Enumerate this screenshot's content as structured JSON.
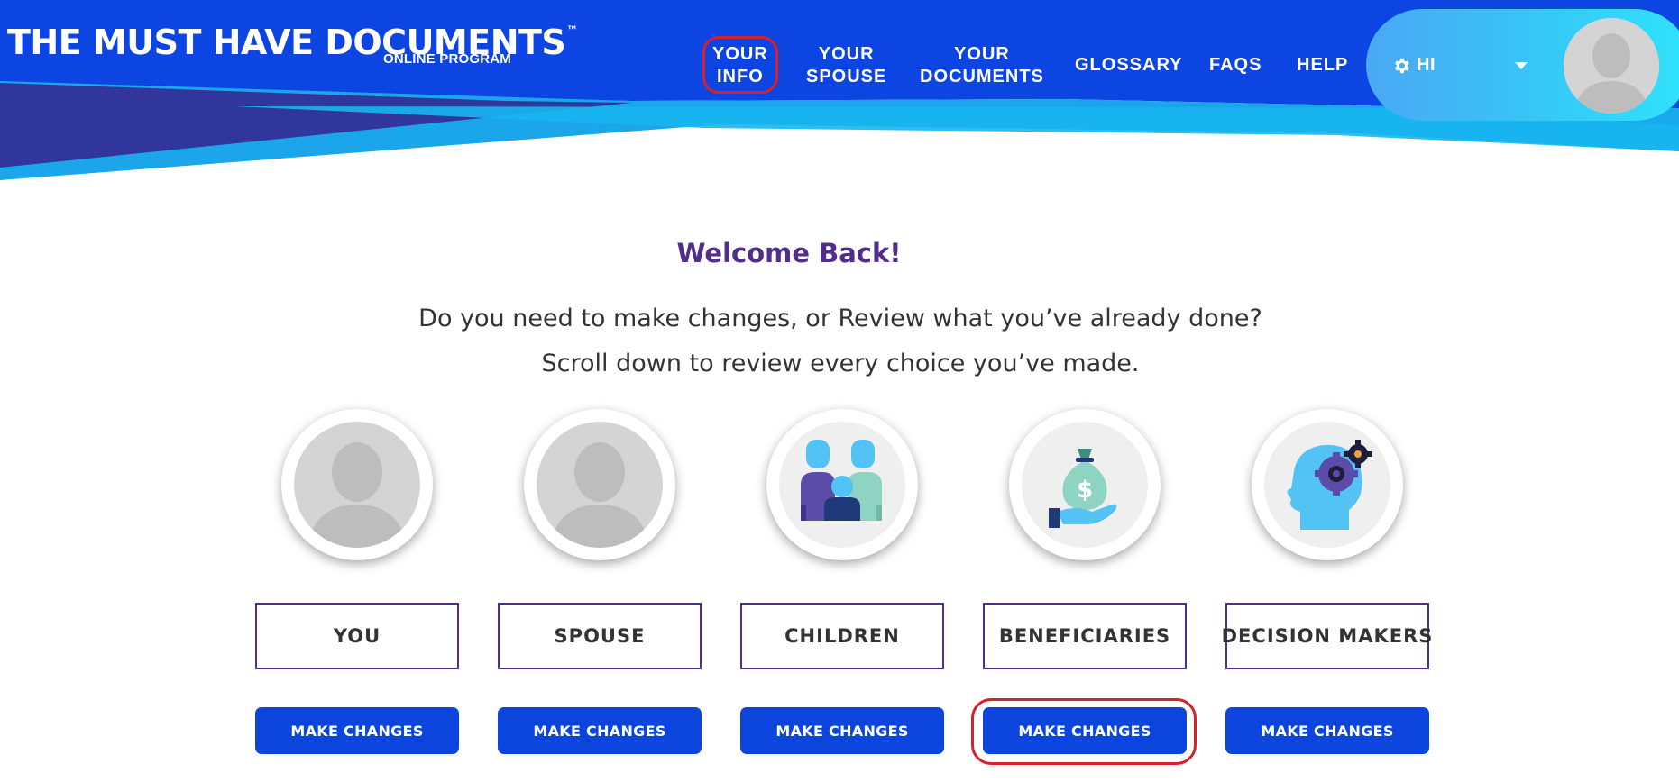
{
  "header": {
    "logo_title": "THE MUST HAVE DOCUMENTS",
    "logo_tm": "™",
    "logo_subtitle": "ONLINE PROGRAM",
    "nav": [
      {
        "line1": "YOUR",
        "line2": "INFO"
      },
      {
        "line1": "YOUR",
        "line2": "SPOUSE"
      },
      {
        "line1": "YOUR",
        "line2": "DOCUMENTS"
      },
      {
        "line1": "GLOSSARY"
      },
      {
        "line1": "FAQS"
      },
      {
        "line1": "HELP"
      }
    ],
    "user_greeting": "HI"
  },
  "main": {
    "welcome": "Welcome Back!",
    "line1": "Do you need to make changes, or Review what you’ve already done?",
    "line2": "Scroll down to review every choice you’ve made.",
    "sections": [
      {
        "label": "YOU",
        "button": "MAKE CHANGES",
        "icon": "person-silhouette-icon"
      },
      {
        "label": "SPOUSE",
        "button": "MAKE CHANGES",
        "icon": "person-silhouette-icon"
      },
      {
        "label": "CHILDREN",
        "button": "MAKE CHANGES",
        "icon": "family-icon"
      },
      {
        "label": "BENEFICIARIES",
        "button": "MAKE CHANGES",
        "icon": "money-bag-hand-icon"
      },
      {
        "label": "DECISION MAKERS",
        "button": "MAKE CHANGES",
        "icon": "head-gear-icon"
      }
    ]
  },
  "colors": {
    "brand_blue": "#0c45de",
    "accent_purple": "#512d8c",
    "highlight_red": "#d8202a"
  }
}
